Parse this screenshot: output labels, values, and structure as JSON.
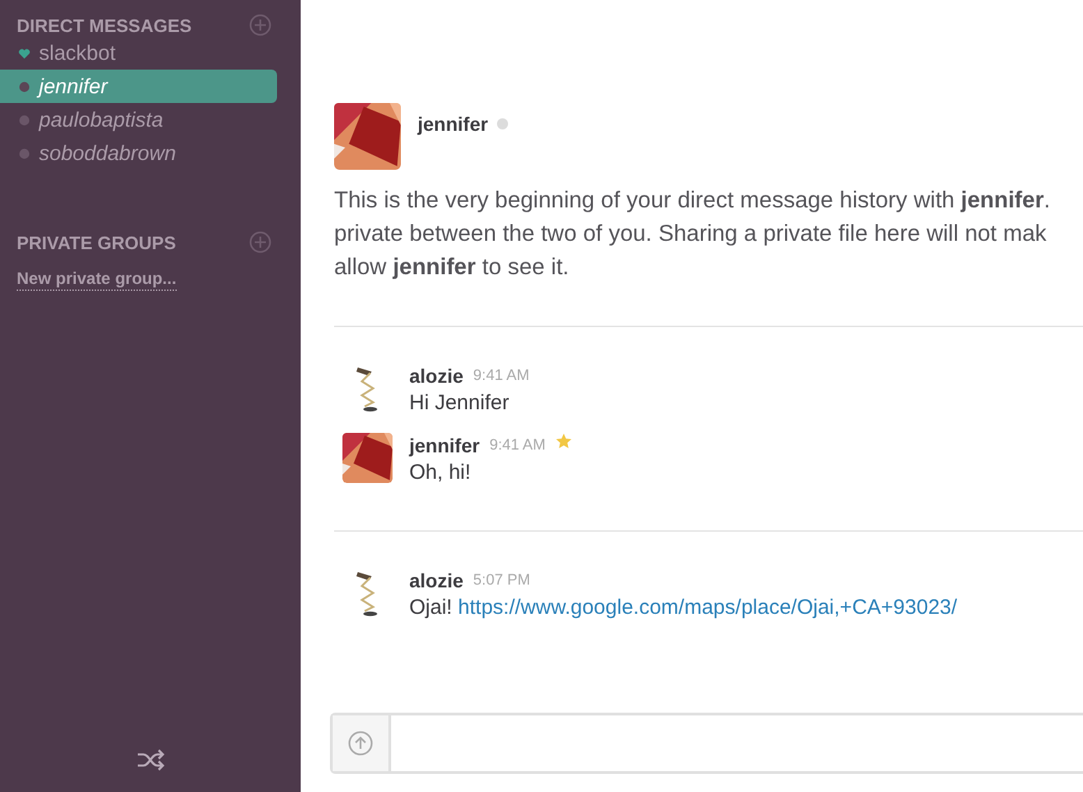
{
  "sidebar": {
    "direct_messages": {
      "title": "DIRECT MESSAGES",
      "items": [
        {
          "label": "slackbot",
          "kind": "bot",
          "selected": false
        },
        {
          "label": "jennifer",
          "kind": "user",
          "selected": true
        },
        {
          "label": "paulobaptista",
          "kind": "user",
          "selected": false
        },
        {
          "label": "soboddabrown",
          "kind": "user",
          "selected": false
        }
      ]
    },
    "private_groups": {
      "title": "PRIVATE GROUPS",
      "link": "New private group..."
    }
  },
  "intro": {
    "name": "jennifer",
    "lines": [
      "This is the very beginning of your direct message history with **jennifer**.",
      "private between the two of you. Sharing a private file here will not mak",
      "allow **jennifer** to see it."
    ]
  },
  "message_groups": [
    {
      "messages": [
        {
          "author": "alozie",
          "kind": "lamp",
          "time": "9:41 AM",
          "text": "Hi Jennifer",
          "starred": false
        },
        {
          "author": "jennifer",
          "kind": "squares",
          "time": "9:41 AM",
          "text": "Oh, hi!",
          "starred": true
        }
      ]
    },
    {
      "messages": [
        {
          "author": "alozie",
          "kind": "lamp",
          "time": "5:07 PM",
          "text": "Ojai!",
          "link": "https://www.google.com/maps/place/Ojai,+CA+93023/",
          "starred": false
        }
      ]
    }
  ]
}
